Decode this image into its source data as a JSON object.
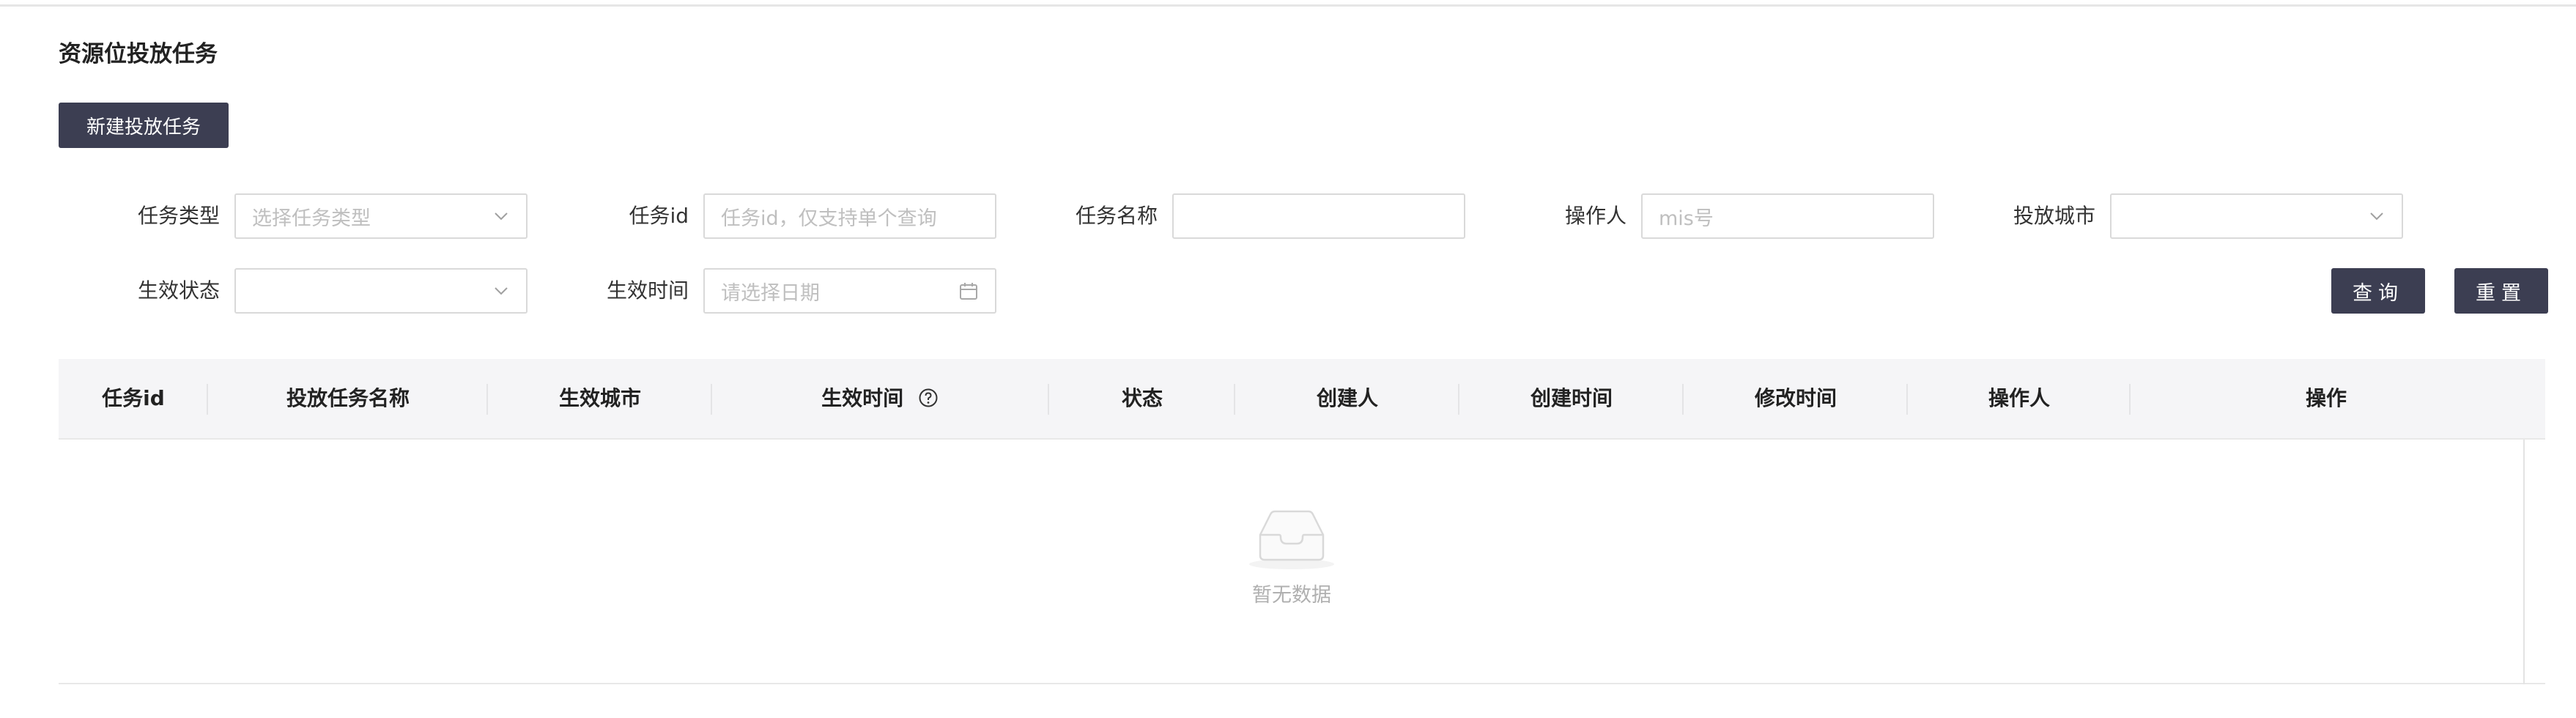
{
  "page": {
    "title": "资源位投放任务",
    "new_button": "新建投放任务"
  },
  "filters": {
    "task_type": {
      "label": "任务类型",
      "placeholder": "选择任务类型"
    },
    "task_id": {
      "label": "任务id",
      "placeholder": "任务id，仅支持单个查询"
    },
    "task_name": {
      "label": "任务名称",
      "placeholder": ""
    },
    "operator": {
      "label": "操作人",
      "placeholder": "mis号"
    },
    "city": {
      "label": "投放城市",
      "placeholder": ""
    },
    "status": {
      "label": "生效状态",
      "placeholder": ""
    },
    "effective_time": {
      "label": "生效时间",
      "placeholder": "请选择日期"
    },
    "query_button": "查询",
    "reset_button": "重置"
  },
  "table": {
    "columns": [
      "任务id",
      "投放任务名称",
      "生效城市",
      "生效时间",
      "状态",
      "创建人",
      "创建时间",
      "修改时间",
      "操作人",
      "操作"
    ],
    "empty_text": "暂无数据"
  },
  "icons": {
    "select_arrow": "chevron-down-icon",
    "date": "calendar-icon",
    "help": "question-circle-icon",
    "empty": "inbox-icon"
  },
  "colors": {
    "primary_button": "#3c3e52",
    "table_header_bg": "#f5f5f7",
    "border": "#d9d9d9"
  }
}
